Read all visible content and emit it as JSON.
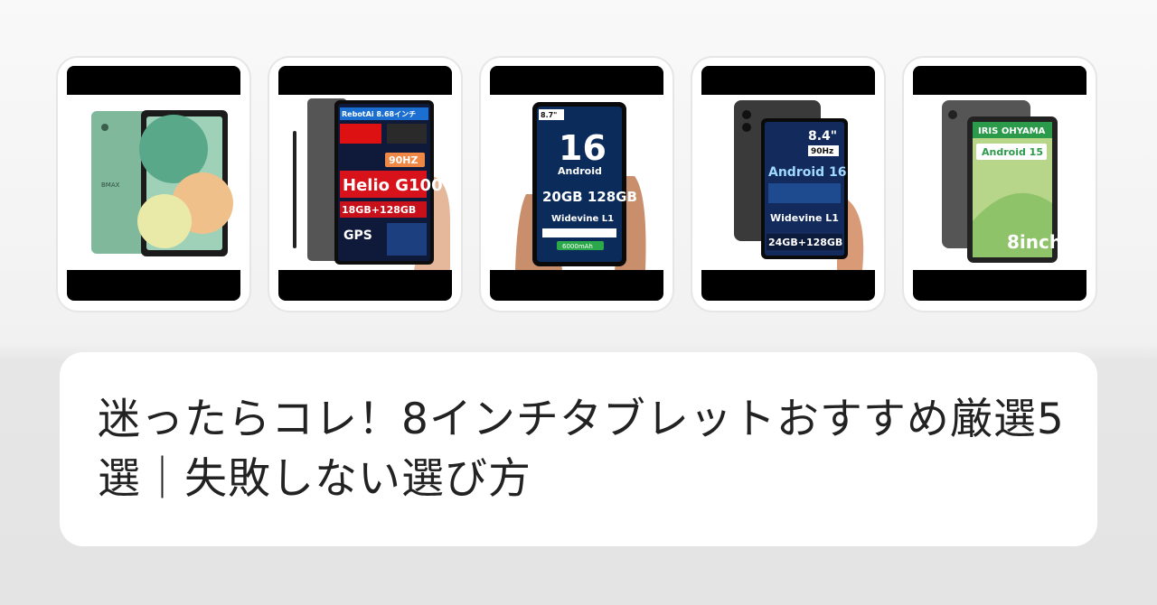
{
  "products": [
    {
      "name": "tablet-1",
      "brand": "BMAX"
    },
    {
      "name": "tablet-2",
      "badge_top": "RebotAi 8.68インチ",
      "refresh": "90HZ",
      "chip": "Helio G100",
      "memory": "18GB+128GB",
      "gps": "GPS"
    },
    {
      "name": "tablet-3",
      "size": "8.7\"",
      "os_version": "16",
      "os": "Android",
      "memory": "20GB 128GB",
      "drm": "Widevine L1",
      "battery": "6000mAh"
    },
    {
      "name": "tablet-4",
      "size": "8.4\"",
      "refresh": "90Hz",
      "os": "Android 16",
      "drm": "Widevine L1",
      "memory": "24GB+128GB"
    },
    {
      "name": "tablet-5",
      "brand": "IRIS OHYAMA",
      "os": "Android 15",
      "size": "8inch"
    }
  ],
  "article": {
    "title": "迷ったらコレ！8インチタブレットおすすめ厳選5選｜失敗しない選び方"
  }
}
